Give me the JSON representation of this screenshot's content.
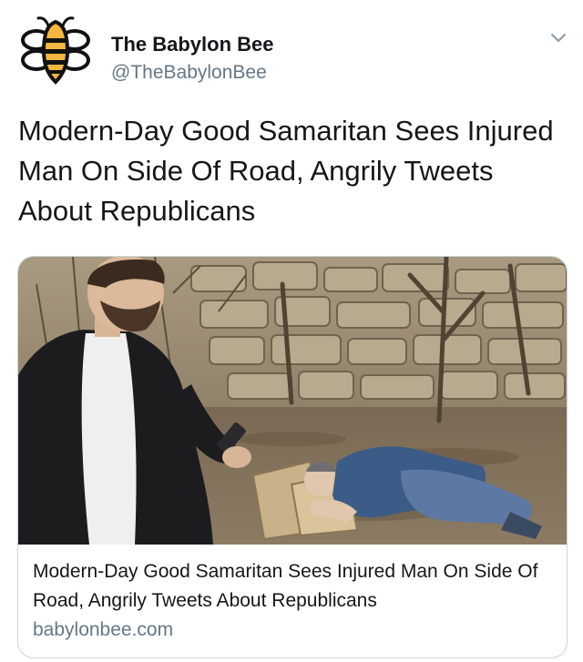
{
  "account": {
    "name": "The Babylon Bee",
    "handle": "@TheBabylonBee",
    "avatar_icon": "bee-logo-icon"
  },
  "tweet": {
    "text": "Modern-Day Good Samaritan Sees Injured Man On Side Of Road, Angrily Tweets About Republicans",
    "menu_icon": "chevron-down-icon"
  },
  "card": {
    "image_description_icon": "article-photo",
    "title": "Modern-Day Good Samaritan Sees Injured Man On Side Of Road, Angrily Tweets About Republicans",
    "domain": "babylonbee.com"
  },
  "colors": {
    "text_primary": "#14171a",
    "text_secondary": "#657786",
    "border": "#ccd6dd",
    "bee_yellow": "#f4b63f"
  }
}
